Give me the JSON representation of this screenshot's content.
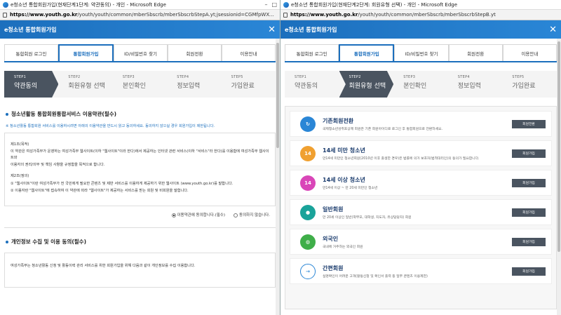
{
  "left": {
    "titlebar": "e청소년 통합회원가입(현재단계1단계: 약관동의) - 개인 - Microsoft Edge",
    "address_host": "https://www.youth.go.kr",
    "address_path": "/youth/youth/common/mberSbscrb/mberSbscrbStepA.yt;jsessionid=CGMfpWXeMuQkIPWkFKWINSTM940y6YbMFycSsiCSy...",
    "app_title": "e청소년 통합회원가입",
    "tabs": [
      "통합회원 로그인",
      "통합회원가입",
      "ID/비밀번호 찾기",
      "회원전환",
      "이용안내"
    ],
    "steps": [
      {
        "num": "STEP1",
        "label": "약관동의"
      },
      {
        "num": "STEP2",
        "label": "회원유형 선택"
      },
      {
        "num": "STEP3",
        "label": "본인확인"
      },
      {
        "num": "STEP4",
        "label": "정보입력"
      },
      {
        "num": "STEP5",
        "label": "가입완료"
      }
    ],
    "section1_title": "청소년활동 통합회원통합서비스 이용약관(필수)",
    "notice": "※ 청소년활동 통합회원 서비스를 이용하시려면 아래의 이용약관을 반드시 읽고 동의하세요. 동의하지 않으실 경우 회원가입이 제한됩니다.",
    "terms": {
      "h1": "제1조(목적)",
      "p1": "이 약관은 여성가족부가 운영하는 여성가족부 웹사이트(이하 \"웹사이트\"이라 한다)에서 제공하는 인터넷 관련 서비스(이하 \"서비스\"라 한다)를 이용함에 여성가족부 웹사이트와",
      "p1b": "이용자의 권리/의무 및 책임 사항을 규정함을 목적으로 합니다.",
      "h2": "제2조(정의)",
      "p2": "① \"웹사이트\"이란 여성가족부가 전 국민에게 필요한 콘텐츠 및 제반 서비스를 이용하게 제공하기 위한 웹사이트 (www.youth.go.kr)를 말합니다.",
      "p3": "② 이용자란 \"웹사이트\"에 접속하여 이 약관에 따라 \"웹사이트\"가 제공하는 서비스를 받는 회원 및 비회원을 말합니다."
    },
    "agree_yes": "이용약관에 동의합니다.(필수)",
    "agree_no": "동의하지 않습니다.",
    "section2_title": "개인정보 수집 및 이용 동의(필수)",
    "terms2": "여성가족부는 청소년활동 신청 및 활동이력 관리 서비스를 위한 회원가입을 위해 다음과 같이 개인정보를 수집 이용합니다."
  },
  "right": {
    "titlebar": "e청소년 통합회원가입(현재단계2단계: 회원유형 선택) - 개인 - Microsoft Edge",
    "address_host": "https://www.youth.go.kr",
    "address_path": "/youth/youth/common/mberSbscrb/mberSbscrbStepB.yt",
    "app_title": "e청소년 통합회원가입",
    "tabs": [
      "통합회원 로그인",
      "통합회원가입",
      "ID/비밀번호 찾기",
      "회원전환",
      "이용안내"
    ],
    "steps": [
      {
        "num": "STEP1",
        "label": "약관동의"
      },
      {
        "num": "STEP2",
        "label": "회원유형 선택"
      },
      {
        "num": "STEP3",
        "label": "본인확인"
      },
      {
        "num": "STEP4",
        "label": "정보입력"
      },
      {
        "num": "STEP5",
        "label": "가입완료"
      }
    ],
    "types": [
      {
        "title": "기존회원전환",
        "desc": "국제청소년성취포상제 회원은 기존 회원아이디로 로그인 후 통합회원으로 전환하세요.",
        "button": "회원전환",
        "icon": "↻",
        "color": "#2a86d6"
      },
      {
        "title": "14세 미만 청소년",
        "desc": "만14세 미만인 청소년회원(2010년 이후 출생한 경우)은 법률에 의거 보호자(법적대리인)의 동의가 필요합니다.",
        "button": "회원가입",
        "icon": "14",
        "color": "#f0a030"
      },
      {
        "title": "14세 이상 청소년",
        "desc": "만14세 이상 ~ 만 20세 미만인 청소년",
        "button": "회원가입",
        "icon": "14",
        "color": "#d946b8"
      },
      {
        "title": "일반회원",
        "desc": "만 20세 이상인 일반(학부모, 대학생, 지도자, 유상담당자) 회원",
        "button": "회원가입",
        "icon": "●",
        "color": "#1aa39a"
      },
      {
        "title": "외국인",
        "desc": "국내에 거주하는 외국인 회원",
        "button": "회원가입",
        "icon": "◍",
        "color": "#3fae49"
      },
      {
        "title": "간편회원",
        "desc": "실명확인이 어려운 고객(활동신청 및 확인서 출력 등 일부 콘텐츠 이용제한)",
        "button": "회원가입",
        "icon": "→",
        "color": "#2a86d6"
      }
    ]
  }
}
